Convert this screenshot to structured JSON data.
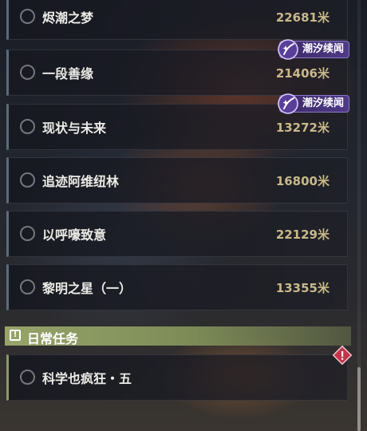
{
  "quests": [
    {
      "title": "烬潮之梦",
      "distance": "22681米",
      "tag": ""
    },
    {
      "title": "一段善缘",
      "distance": "21406米",
      "tag": "潮汐续闻"
    },
    {
      "title": "现状与未来",
      "distance": "13272米",
      "tag": "潮汐续闻"
    },
    {
      "title": "追迹阿维纽林",
      "distance": "16800米",
      "tag": ""
    },
    {
      "title": "以呼嚎致意",
      "distance": "22129米",
      "tag": ""
    },
    {
      "title": "黎明之星（一）",
      "distance": "13355米",
      "tag": ""
    }
  ],
  "daily_section": {
    "label": "日常任务",
    "icon": "exclamation-box-icon"
  },
  "daily_quests": [
    {
      "title": "科学也疯狂・五",
      "alert_icon": "warning-diamond-icon"
    }
  ],
  "colors": {
    "tag_bg": "#4e3a86",
    "distance": "#c9b989",
    "section_bg": "#97a56a",
    "alert": "#c2354a"
  }
}
